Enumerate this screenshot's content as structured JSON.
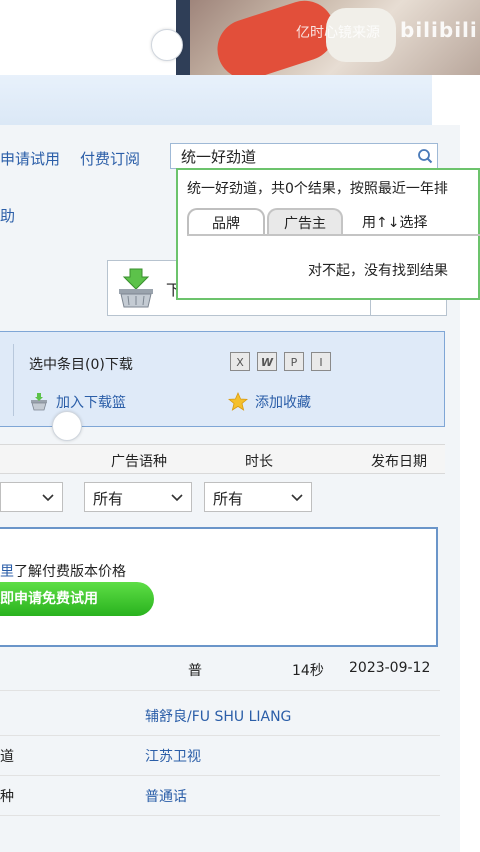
{
  "video": {
    "watermark": "亿时心镜来源",
    "logo": "bilibili"
  },
  "nav": {
    "trial": "申请试用",
    "subscribe": "付费订阅",
    "help": "助"
  },
  "search": {
    "value": "统一好劲道"
  },
  "suggest": {
    "summary": "统一好劲道，共0个结果，按照最近一年排",
    "tab_brand": "品牌",
    "tab_advertiser": "广告主",
    "hint": "用↑↓选择",
    "empty": "对不起，没有找到结果"
  },
  "download": {
    "label": "下"
  },
  "selection": {
    "count_label": "选中条目(0)下载",
    "formats": [
      "X",
      "W",
      "P",
      "I"
    ],
    "add_basket": "加入下载篮",
    "add_favorite": "添加收藏"
  },
  "table": {
    "headers": {
      "language": "广告语种",
      "duration": "时长",
      "date": "发布日期"
    },
    "filters": [
      "",
      "所有",
      "所有"
    ],
    "promo_text_blue": "里",
    "promo_text": "了解付费版本价格",
    "promo_button": "即申请免费试用",
    "row": {
      "language": "普",
      "duration": "14秒",
      "date": "2023-09-12"
    },
    "details": {
      "person_value": "辅舒良/FU SHU LIANG",
      "channel_label": "道",
      "channel_value": "江苏卫视",
      "lang_label": "种",
      "lang_value": "普通话"
    }
  },
  "colors": {
    "link": "#2b5ea8",
    "suggest_border": "#6cc36c",
    "button_green": "#29b21e",
    "panel_blue": "#dfeaf8"
  }
}
